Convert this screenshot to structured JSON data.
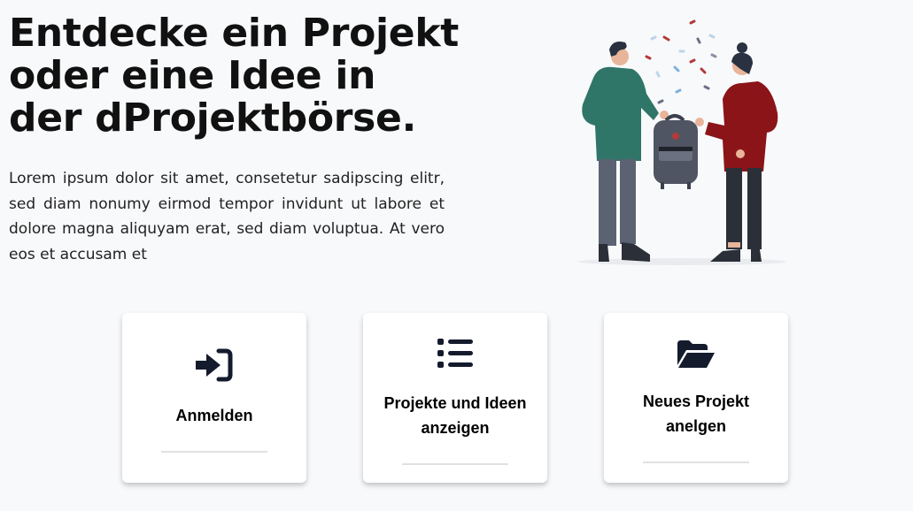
{
  "hero": {
    "title_lines": [
      "Entdecke ein Projekt",
      "oder eine Idee in",
      "der dProjektbörse."
    ],
    "description": "Lorem ipsum dolor sit amet, consetetur sadipscing elitr, sed diam nonumy eirmod tempor invidunt ut labore et dolore magna aliquyam erat, sed diam voluptua. At vero eos et accusam et"
  },
  "cards": [
    {
      "label": "Anmelden",
      "icon": "sign-in-icon"
    },
    {
      "label": "Projekte und Ideen anzeigen",
      "icon": "list-icon"
    },
    {
      "label": "Neues Projekt anelgen",
      "icon": "folder-open-icon"
    }
  ],
  "colors": {
    "background": "#f8f9fb",
    "icon": "#141b2d",
    "green_hoodie": "#2f7568",
    "red_hoodie": "#8b1419"
  }
}
